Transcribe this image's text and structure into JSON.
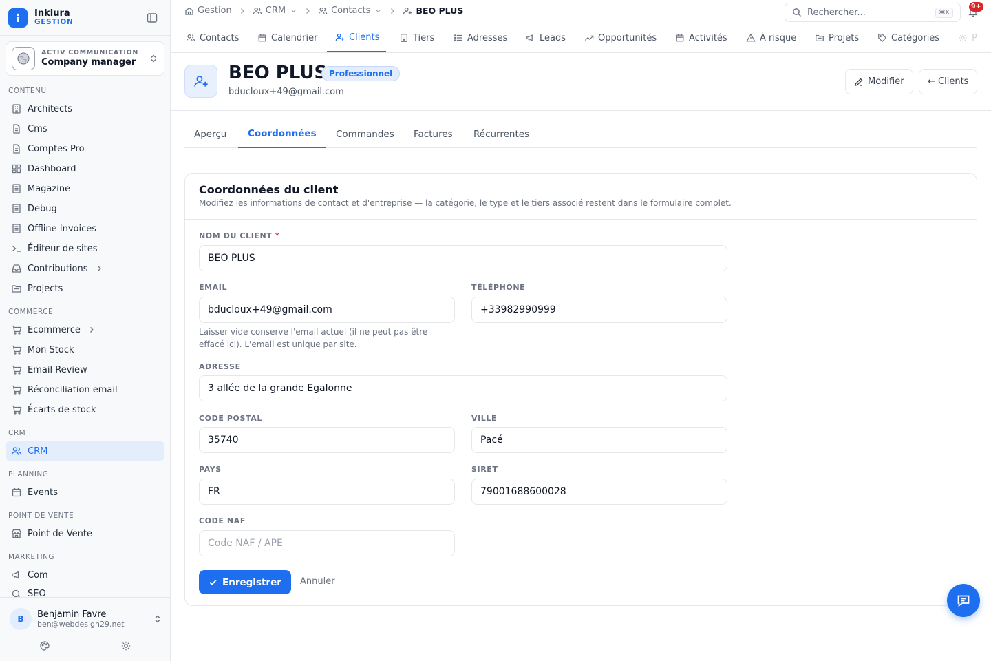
{
  "brand": {
    "name": "Inklura",
    "sub": "GESTION"
  },
  "org": {
    "kicker": "ACTIV COMMUNICATION",
    "name": "Company manager"
  },
  "sidebar": {
    "sections": {
      "contenu": "CONTENU",
      "commerce": "COMMERCE",
      "crm": "CRM",
      "planning": "PLANNING",
      "pos": "POINT DE VENTE",
      "marketing": "MARKETING"
    },
    "items": {
      "architects": "Architects",
      "cms": "Cms",
      "comptes_pro": "Comptes Pro",
      "dashboard": "Dashboard",
      "magazine": "Magazine",
      "debug": "Debug",
      "offline_invoices": "Offline Invoices",
      "editeur": "Éditeur de sites",
      "contributions": "Contributions",
      "projects": "Projects",
      "ecommerce": "Ecommerce",
      "mon_stock": "Mon Stock",
      "email_review": "Email Review",
      "reconciliation": "Réconciliation email",
      "ecarts": "Écarts de stock",
      "crm": "CRM",
      "events": "Events",
      "point_de_vente": "Point de Vente",
      "com": "Com",
      "seo": "SEO"
    }
  },
  "user": {
    "initial": "B",
    "name": "Benjamin Favre",
    "email": "ben@webdesign29.net"
  },
  "breadcrumb": {
    "gestion": "Gestion",
    "crm": "CRM",
    "contacts": "Contacts",
    "current": "BEO PLUS"
  },
  "search": {
    "placeholder": "Rechercher...",
    "shortcut": "⌘K"
  },
  "notifications": {
    "badge": "9+"
  },
  "module_tabs": {
    "contacts": "Contacts",
    "calendrier": "Calendrier",
    "clients": "Clients",
    "tiers": "Tiers",
    "adresses": "Adresses",
    "leads": "Leads",
    "opportunites": "Opportunités",
    "activites": "Activités",
    "a_risque": "À risque",
    "projets": "Projets",
    "categories": "Catégories",
    "truncated": "P"
  },
  "entity": {
    "title": "BEO PLUS",
    "badge": "Professionnel",
    "email": "bducloux+49@gmail.com",
    "edit_label": "Modifier",
    "back_label": "← Clients"
  },
  "sub_tabs": {
    "apercu": "Aperçu",
    "coordonnees": "Coordonnées",
    "commandes": "Commandes",
    "factures": "Factures",
    "recurrentes": "Récurrentes"
  },
  "form": {
    "title": "Coordonnées du client",
    "description": "Modifiez les informations de contact et d'entreprise — la catégorie, le type et le tiers associé restent dans le formulaire complet.",
    "name_label": "NOM DU CLIENT",
    "name_required": "*",
    "name_value": "BEO PLUS",
    "email_label": "EMAIL",
    "email_value": "bducloux+49@gmail.com",
    "email_help": "Laisser vide conserve l'email actuel (il ne peut pas être effacé ici). L'email est unique par site.",
    "phone_label": "TÉLÉPHONE",
    "phone_value": "+33982990999",
    "address_label": "ADRESSE",
    "address_value": "3 allée de la grande Egalonne",
    "postal_label": "CODE POSTAL",
    "postal_value": "35740",
    "city_label": "VILLE",
    "city_value": "Pacé",
    "country_label": "PAYS",
    "country_value": "FR",
    "siret_label": "SIRET",
    "siret_value": "79001688600028",
    "naf_label": "CODE NAF",
    "naf_placeholder": "Code NAF / APE",
    "save_label": "Enregistrer",
    "cancel_label": "Annuler"
  },
  "colors": {
    "accent": "#1d6ff0",
    "danger": "#dc2626",
    "border": "#e5e7eb",
    "muted": "#6b7280"
  }
}
